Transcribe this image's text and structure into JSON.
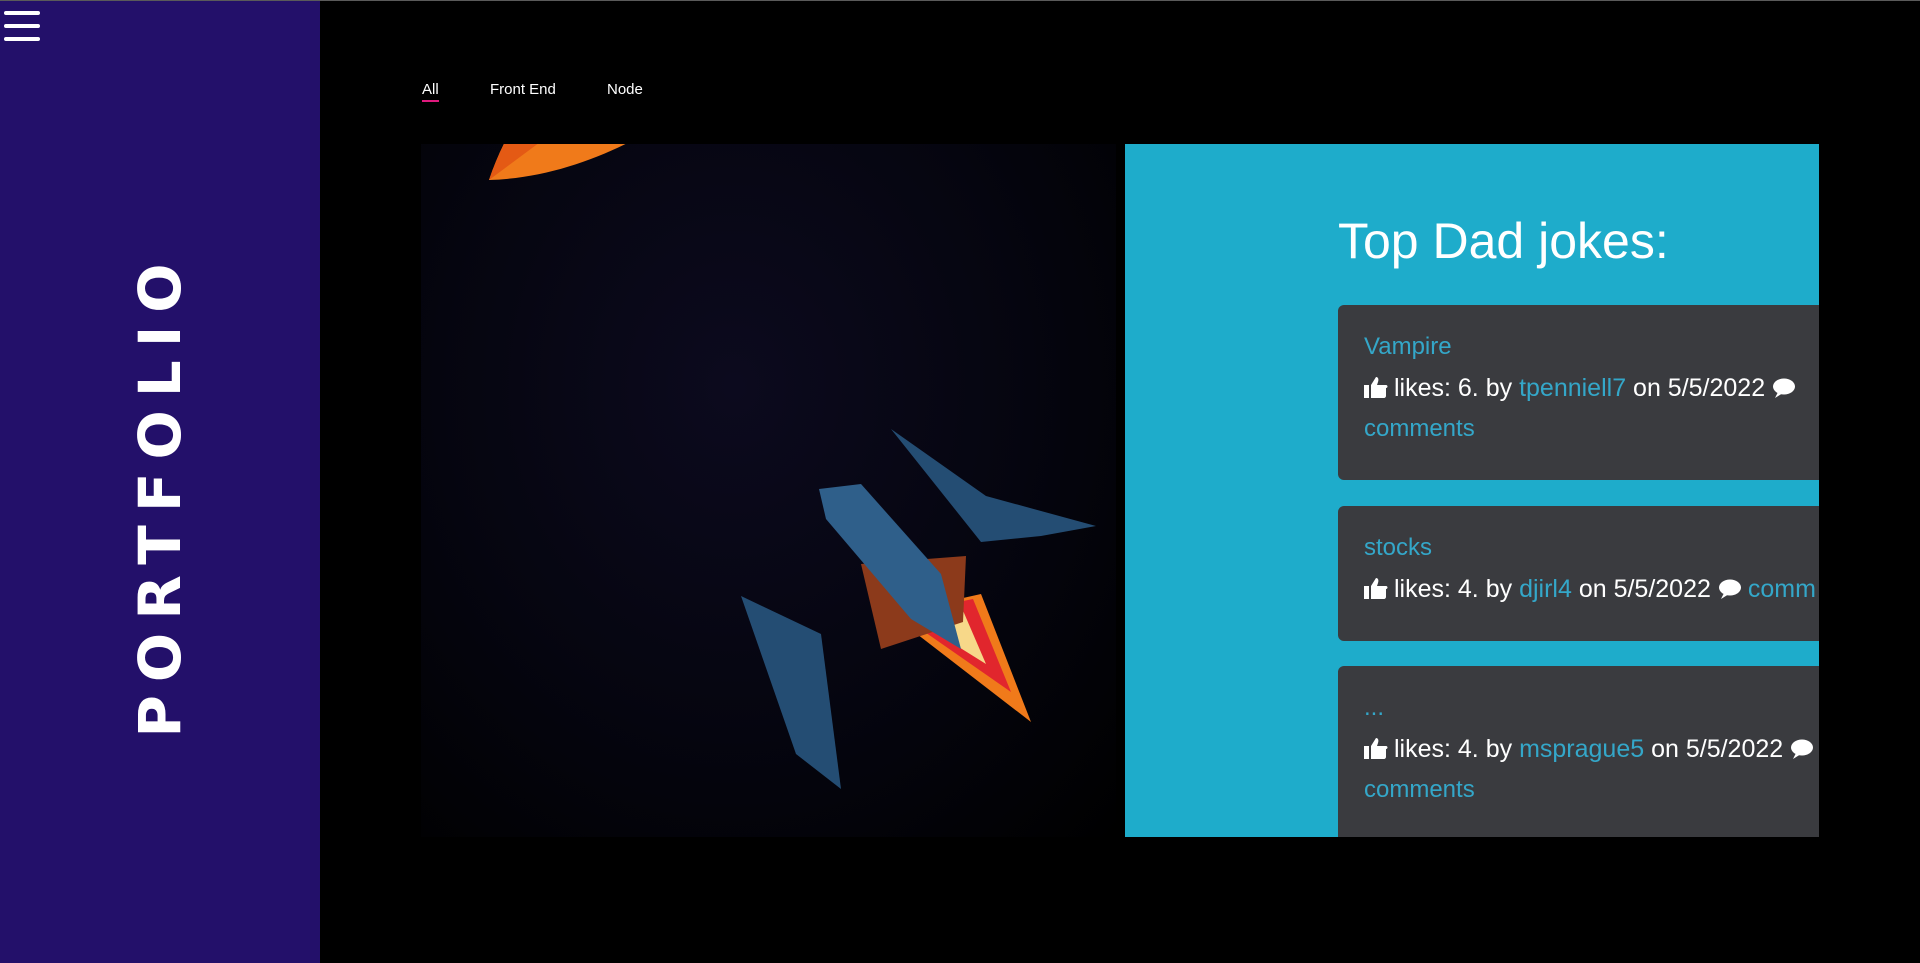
{
  "sidebar": {
    "menu_icon": "hamburger-menu-icon",
    "title": "PORTFOLIO",
    "background": "#23106a"
  },
  "filters": {
    "items": [
      {
        "label": "All",
        "active": true
      },
      {
        "label": "Front End",
        "active": false
      },
      {
        "label": "Node",
        "active": false
      }
    ],
    "active_underline_color": "#e0197d"
  },
  "projects": [
    {
      "image": "rocket-illustration",
      "colors": {
        "orange": "#f07a1a",
        "body": "#e9e9ea",
        "fin": "#244d73",
        "window": "#34c3ef"
      }
    },
    {
      "image": "dad-jokes-screenshot",
      "background": "#1eaccb",
      "title": "Top Dad jokes:",
      "jokes": [
        {
          "title": "Vampire",
          "likes_text": "likes: 6. by",
          "user": "tpenniell7",
          "date_text": "on 5/5/2022",
          "comments": "comments"
        },
        {
          "title": "stocks",
          "likes_text": "likes: 4. by",
          "user": "djirl4",
          "date_text": "on 5/5/2022",
          "comments": "comm"
        },
        {
          "title": "...",
          "likes_text": "likes: 4. by",
          "user": "msprague5",
          "date_text": "on 5/5/2022",
          "comments": "comments"
        }
      ]
    }
  ]
}
